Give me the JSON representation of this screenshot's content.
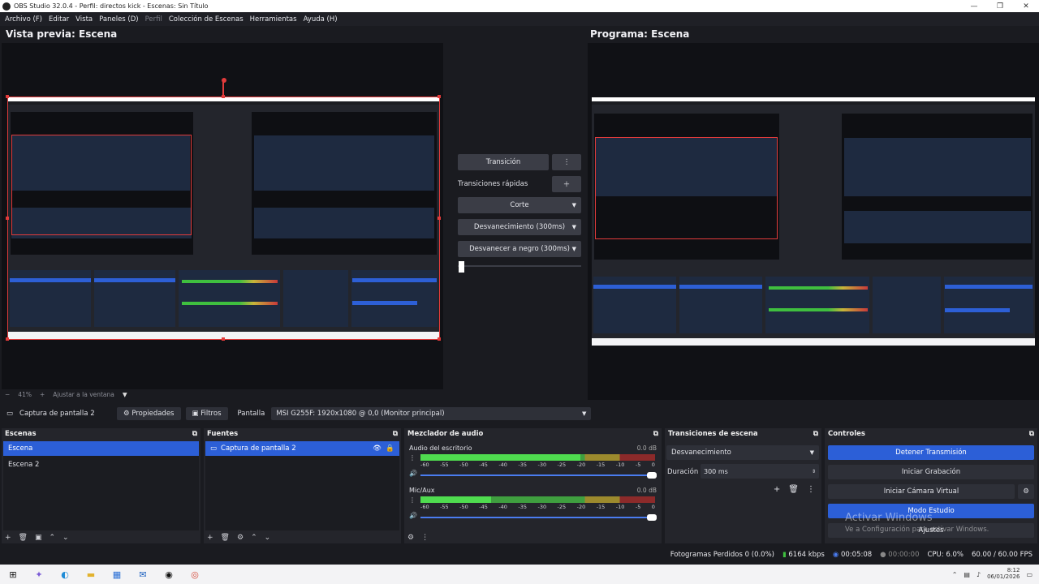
{
  "window": {
    "title": "OBS Studio 32.0.4 - Perfil: directos kick - Escenas: Sin Título"
  },
  "menu": [
    "Archivo (F)",
    "Editar",
    "Vista",
    "Paneles (D)",
    "Perfil",
    "Colección de Escenas",
    "Herramientas",
    "Ayuda (H)"
  ],
  "preview": {
    "title": "Vista previa: Escena",
    "zoom": "41%",
    "fit_label": "Ajustar a la ventana"
  },
  "program": {
    "title": "Programa: Escena"
  },
  "transition_panel": {
    "transition_button": "Transición",
    "quick_label": "Transiciones rápidas",
    "quick_items": [
      "Corte",
      "Desvanecimiento (300ms)",
      "Desvanecer a negro (300ms)"
    ]
  },
  "source_toolbar": {
    "source": "Captura de pantalla 2",
    "properties": "Propiedades",
    "filters": "Filtros",
    "display_label": "Pantalla",
    "display_value": "MSI G255F: 1920x1080 @ 0,0 (Monitor principal)"
  },
  "scenes": {
    "title": "Escenas",
    "items": [
      "Escena",
      "Escena 2"
    ]
  },
  "sources": {
    "title": "Fuentes",
    "items": [
      "Captura de pantalla 2"
    ]
  },
  "mixer": {
    "title": "Mezclador de audio",
    "ticks": [
      "-60",
      "-55",
      "-50",
      "-45",
      "-40",
      "-35",
      "-30",
      "-25",
      "-20",
      "-15",
      "-10",
      "-5",
      "0"
    ],
    "channels": [
      {
        "name": "Audio del escritorio",
        "db": "0.0 dB",
        "level": 0.68
      },
      {
        "name": "Mic/Aux",
        "db": "0.0 dB",
        "level": 0.3
      }
    ]
  },
  "scene_transitions": {
    "title": "Transiciones de escena",
    "type": "Desvanecimiento",
    "duration_label": "Duración",
    "duration_value": "300 ms"
  },
  "controls": {
    "title": "Controles",
    "buttons": [
      "Detener Transmisión",
      "Iniciar Grabación",
      "Iniciar Cámara Virtual",
      "Modo Estudio",
      "Ajustes"
    ]
  },
  "watermark": {
    "line1": "Activar Windows",
    "line2": "Ve a Configuración para activar Windows."
  },
  "status": {
    "dropped": "Fotogramas Perdidos 0 (0.0%)",
    "bitrate": "6164 kbps",
    "stream_time": "00:05:08",
    "rec_time": "00:00:00",
    "cpu": "CPU: 6.0%",
    "fps": "60.00 / 60.00 FPS"
  },
  "taskbar": {
    "time": "8:12",
    "date": "06/01/2026"
  },
  "colors": {
    "accent": "#2c5fd7",
    "selection_red": "#e23b3b",
    "bg": "#1a1b20",
    "panel": "#24252b"
  }
}
